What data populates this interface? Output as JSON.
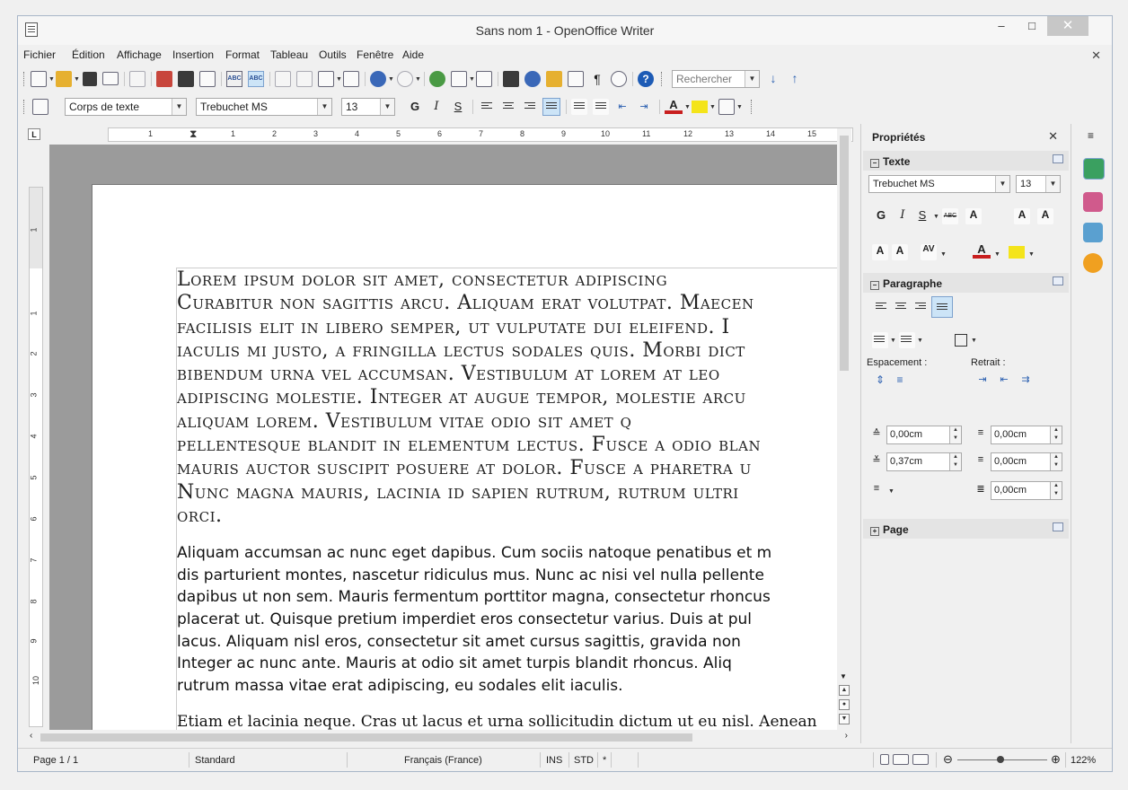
{
  "window": {
    "title": "Sans nom 1 - OpenOffice Writer",
    "minimize": "–",
    "maximize": "□",
    "close": "✕",
    "doc_close": "✕"
  },
  "menu": [
    "Fichier",
    "Édition",
    "Affichage",
    "Insertion",
    "Format",
    "Tableau",
    "Outils",
    "Fenêtre",
    "Aide"
  ],
  "toolbar": {
    "search_placeholder": "Rechercher"
  },
  "formatting": {
    "style": "Corps de texte",
    "font": "Trebuchet MS",
    "size": "13",
    "bold": "G",
    "italic": "I",
    "underline": "S",
    "font_color_letter": "A"
  },
  "ruler": {
    "corner": "L",
    "h_labels": [
      "1",
      "1",
      "2",
      "3",
      "4",
      "5",
      "6",
      "7",
      "8",
      "9",
      "10",
      "11",
      "12",
      "13",
      "14",
      "15"
    ],
    "v_labels": [
      "1",
      "1",
      "2",
      "3",
      "4",
      "5",
      "6",
      "7",
      "8",
      "9",
      "10"
    ]
  },
  "document": {
    "para1": [
      "Lorem ipsum dolor sit amet, consectetur adipiscing",
      "Curabitur non sagittis arcu. Aliquam erat volutpat. Maecen",
      "facilisis elit in libero semper, ut vulputate dui eleifend. I",
      "iaculis mi justo, a fringilla lectus sodales quis. Morbi dict",
      "bibendum urna vel accumsan. Vestibulum at lorem at leo",
      "adipiscing molestie. Integer at augue tempor, molestie arcu",
      "aliquam lorem. Vestibulum vitae odio sit amet q",
      "pellentesque blandit in elementum lectus. Fusce a odio blan",
      "mauris auctor suscipit posuere at dolor. Fusce a pharetra u",
      "Nunc magna mauris, lacinia id sapien rutrum, rutrum ultri",
      "orci."
    ],
    "para2": [
      "Aliquam accumsan ac nunc eget dapibus. Cum sociis natoque penatibus et m",
      "dis parturient montes, nascetur ridiculus mus. Nunc ac nisi vel nulla pellente",
      "dapibus ut non sem. Mauris fermentum porttitor magna, consectetur rhoncus",
      "placerat ut. Quisque pretium imperdiet eros consectetur varius. Duis at pul",
      "lacus. Aliquam nisl eros, consectetur sit amet cursus sagittis, gravida non",
      "Integer ac nunc ante. Mauris at odio sit amet turpis blandit rhoncus. Aliq",
      "rutrum massa vitae erat adipiscing, eu sodales elit iaculis."
    ],
    "para3": "Etiam et lacinia neque. Cras ut lacus et urna sollicitudin dictum ut eu nisl. Aenean"
  },
  "sidebar": {
    "title": "Propriétés",
    "close": "✕",
    "texte": {
      "header": "Texte",
      "font": "Trebuchet MS",
      "size": "13"
    },
    "paragraphe": {
      "header": "Paragraphe",
      "spacing_label": "Espacement :",
      "indent_label": "Retrait :",
      "above": "0,00cm",
      "below": "0,37cm",
      "indent_before": "0,00cm",
      "indent_after": "0,00cm",
      "first_line": "0,00cm"
    },
    "page": {
      "header": "Page"
    }
  },
  "status": {
    "page": "Page 1 / 1",
    "style": "Standard",
    "language": "Français (France)",
    "ins": "INS",
    "std": "STD",
    "modified": "*",
    "zoom": "122%"
  },
  "colors": {
    "accent": "#3a68b8",
    "highlight": "#f4e41a",
    "font_red": "#c81e1e"
  }
}
